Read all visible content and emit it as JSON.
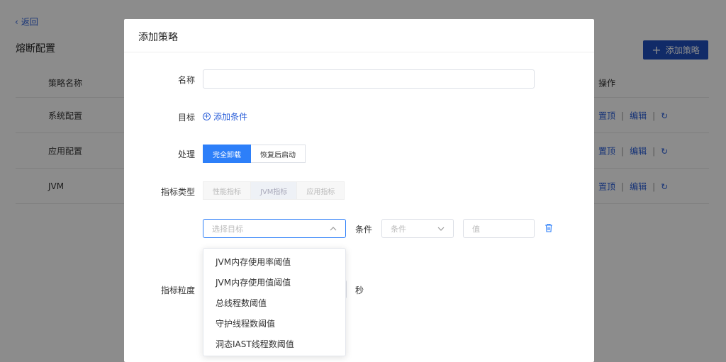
{
  "background": {
    "back_label": "返回",
    "title": "熔断配置",
    "add_button": "添加策略",
    "table": {
      "col_name": "策略名称",
      "col_ops": "操作",
      "rows": [
        {
          "name": "系统配置",
          "op_top": "置顶",
          "op_edit": "编辑"
        },
        {
          "name": "应用配置",
          "op_top": "置顶",
          "op_edit": "编辑"
        },
        {
          "name": "JVM",
          "op_top": "置顶",
          "op_edit": "编辑"
        }
      ],
      "separator": "|"
    }
  },
  "modal": {
    "title": "添加策略",
    "name_label": "名称",
    "name_value": "",
    "target_label": "目标",
    "add_condition": "添加条件",
    "handle_label": "处理",
    "handle_options": [
      "完全卸载",
      "恢复后启动"
    ],
    "metric_type_label": "指标类型",
    "metric_type_options": [
      "性能指标",
      "JVM指标",
      "应用指标"
    ],
    "target_select_placeholder": "选择目标",
    "condition_label": "条件",
    "condition_placeholder": "条件",
    "value_placeholder": "值",
    "granularity_label": "指标粒度",
    "seconds_label": "秒",
    "dropdown_options": [
      "JVM内存使用率阈值",
      "JVM内存使用值阈值",
      "总线程数阈值",
      "守护线程数阈值",
      "洞态IAST线程数阈值"
    ]
  },
  "colors": {
    "primary": "#2d7ff9",
    "link": "#2b5fd9",
    "dark_button": "#1f4fbd"
  }
}
